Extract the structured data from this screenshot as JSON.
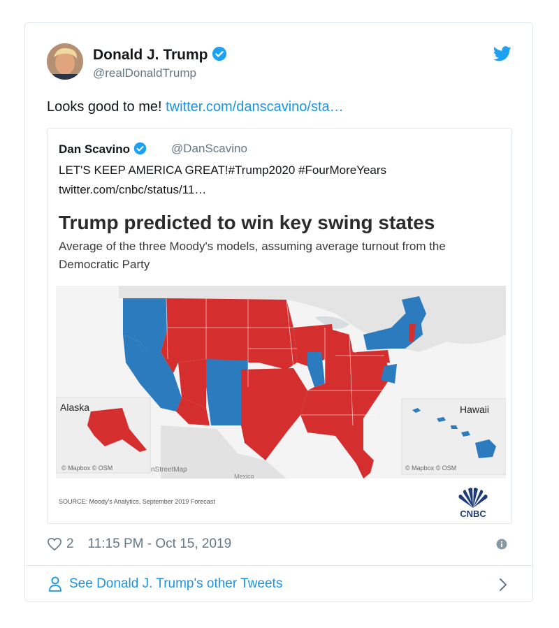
{
  "author": {
    "name": "Donald J. Trump",
    "handle": "@realDonaldTrump"
  },
  "tweet": {
    "text": "Looks good to me! ",
    "link": "twitter.com/danscavino/sta…"
  },
  "quoted": {
    "name": "Dan Scavino",
    "handle": "@DanScavino",
    "text": "LET'S KEEP AMERICA GREAT!#Trump2020 #FourMoreYears",
    "link": "twitter.com/cnbc/status/11…"
  },
  "graphic": {
    "title": "Trump predicted to win key swing states",
    "subtitle": "Average of the three Moody's models, assuming average turnout from the Democratic Party",
    "inset_alaska": "Alaska",
    "inset_hawaii": "Hawaii",
    "credit_left": "© Mapbox © OSM",
    "credit_right": "© Mapbox © OSM",
    "map_label_osm": "nStreetMap",
    "map_label_mexico": "Mexico",
    "source": "SOURCE: Moody's Analytics, September 2019 Forecast",
    "brand": "CNBC",
    "colors": {
      "republican": "#d42e2e",
      "democrat": "#2c7bbf",
      "land": "#e9e9e9",
      "water": "#f6f6f6"
    }
  },
  "meta": {
    "likes": "2",
    "timestamp": "11:15 PM - Oct 15, 2019"
  },
  "footer": {
    "label": "See Donald J. Trump's other Tweets"
  },
  "icons": [
    "verified-icon",
    "twitter-bird-icon",
    "heart-icon",
    "info-icon",
    "person-icon",
    "chevron-right-icon"
  ]
}
